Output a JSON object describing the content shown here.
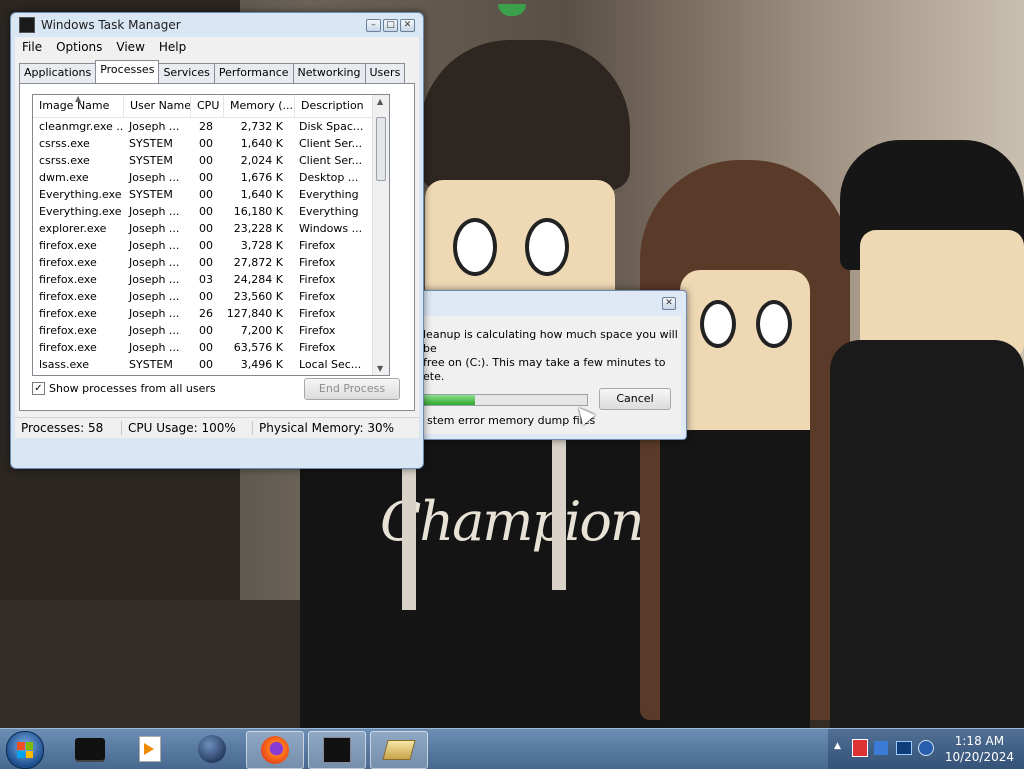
{
  "task_manager": {
    "title": "Windows Task Manager",
    "menu": [
      "File",
      "Options",
      "View",
      "Help"
    ],
    "tabs": [
      "Applications",
      "Processes",
      "Services",
      "Performance",
      "Networking",
      "Users"
    ],
    "active_tab": "Processes",
    "columns": [
      "Image Name",
      "User Name",
      "CPU",
      "Memory (...",
      "Description"
    ],
    "rows": [
      [
        "cleanmgr.exe ...",
        "Joseph ...",
        "28",
        "2,732 K",
        "Disk Spac..."
      ],
      [
        "csrss.exe",
        "SYSTEM",
        "00",
        "1,640 K",
        "Client Ser..."
      ],
      [
        "csrss.exe",
        "SYSTEM",
        "00",
        "2,024 K",
        "Client Ser..."
      ],
      [
        "dwm.exe",
        "Joseph ...",
        "00",
        "1,676 K",
        "Desktop ..."
      ],
      [
        "Everything.exe",
        "SYSTEM",
        "00",
        "1,640 K",
        "Everything"
      ],
      [
        "Everything.exe",
        "Joseph ...",
        "00",
        "16,180 K",
        "Everything"
      ],
      [
        "explorer.exe",
        "Joseph ...",
        "00",
        "23,228 K",
        "Windows ..."
      ],
      [
        "firefox.exe",
        "Joseph ...",
        "00",
        "3,728 K",
        "Firefox"
      ],
      [
        "firefox.exe",
        "Joseph ...",
        "00",
        "27,872 K",
        "Firefox"
      ],
      [
        "firefox.exe",
        "Joseph ...",
        "03",
        "24,284 K",
        "Firefox"
      ],
      [
        "firefox.exe",
        "Joseph ...",
        "00",
        "23,560 K",
        "Firefox"
      ],
      [
        "firefox.exe",
        "Joseph ...",
        "26",
        "127,840 K",
        "Firefox"
      ],
      [
        "firefox.exe",
        "Joseph ...",
        "00",
        "7,200 K",
        "Firefox"
      ],
      [
        "firefox.exe",
        "Joseph ...",
        "00",
        "63,576 K",
        "Firefox"
      ],
      [
        "lsass.exe",
        "SYSTEM",
        "00",
        "3,496 K",
        "Local Sec..."
      ]
    ],
    "show_all_label": "Show processes from all users",
    "show_all_checked": true,
    "end_process_label": "End Process",
    "status": {
      "processes": "Processes: 58",
      "cpu": "CPU Usage: 100%",
      "memory": "Physical Memory: 30%"
    }
  },
  "cleanup_dialog": {
    "message_line1": "leanup is calculating how much space you will be",
    "message_line2": "free on  (C:). This may take a few minutes to",
    "message_line3": "ete.",
    "progress": 0.32,
    "cancel_label": "Cancel",
    "current_item": "stem error memory dump files"
  },
  "wallpaper": {
    "shirt_text": "Champion"
  },
  "taskbar": {
    "time": "1:18 AM",
    "date": "10/20/2024"
  },
  "colors": {
    "progress_fill": "#3fbf3f",
    "taskbar": "#5a7ca3"
  }
}
